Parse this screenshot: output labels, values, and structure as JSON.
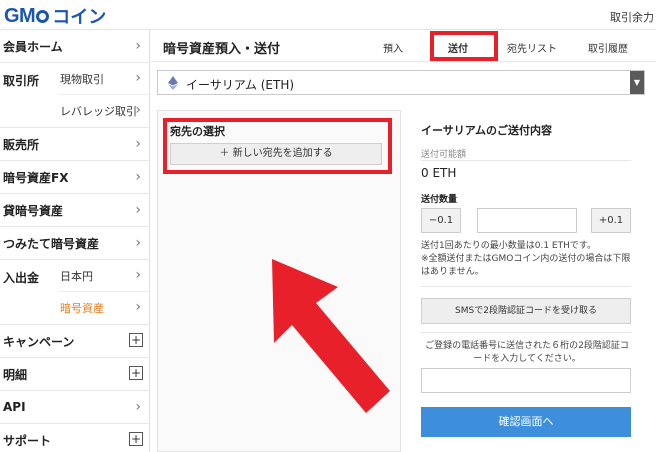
{
  "header": {
    "logo_prefix": "GM",
    "logo_suffix": "コイン",
    "right_link": "取引余力"
  },
  "sidebar": {
    "member_home": "会員ホーム",
    "exchange": {
      "label": "取引所",
      "items": [
        "現物取引",
        "レバレッジ取引"
      ]
    },
    "sales": "販売所",
    "fx": "暗号資産FX",
    "lending": "貸暗号資産",
    "tsumitate": "つみたて暗号資産",
    "deposit": {
      "label": "入出金",
      "items": [
        "日本円",
        "暗号資産"
      ]
    },
    "campaign": "キャンペーン",
    "statement": "明細",
    "api": "API",
    "support": "サポート"
  },
  "main": {
    "title": "暗号資産預入・送付",
    "tabs": {
      "deposit": "預入",
      "send": "送付",
      "address_list": "宛先リスト",
      "history": "取引履歴"
    },
    "coin_select": "イーサリアム (ETH)",
    "destination": {
      "label": "宛先の選択",
      "add_button": "＋ 新しい宛先を追加する"
    },
    "summary": {
      "title": "イーサリアムのご送付内容",
      "available_label": "送付可能額",
      "available_value": "0 ETH",
      "quantity_label": "送付数量",
      "minus": "−0.1",
      "plus": "+0.1",
      "note1": "送付1回あたりの最小数量は0.1 ETHです。",
      "note2": "※全額送付またはGMOコイン内の送付の場合は下限はありません。",
      "sms_button": "SMSで2段階認証コードを受け取る",
      "code_note": "ご登録の電話番号に送信された６桁の2段階認証コードを入力してください。",
      "confirm_button": "確認画面へ"
    }
  },
  "colors": {
    "brand": "#1a56b0",
    "highlight": "#e8202a",
    "active_sub": "#e87b1a",
    "confirm": "#3d8fdc"
  }
}
